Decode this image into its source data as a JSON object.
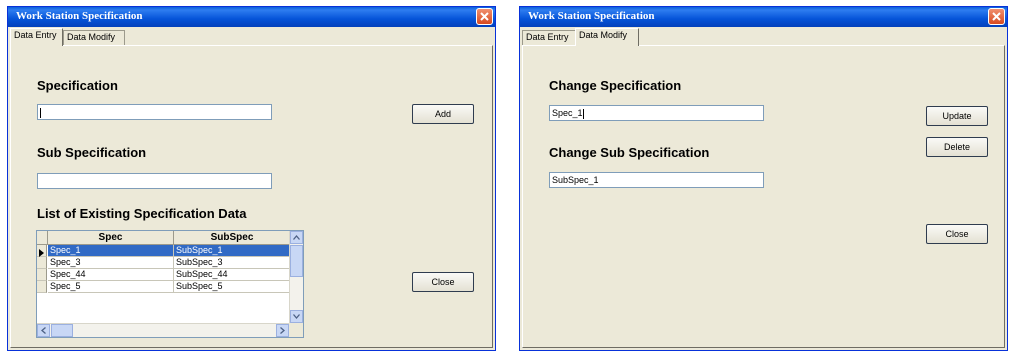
{
  "windows": [
    {
      "title": "Work Station Specification",
      "tabs": [
        "Data Entry",
        "Data Modify"
      ],
      "active_tab": "Data Entry",
      "specification_label": "Specification",
      "specification_value": "",
      "sub_specification_label": "Sub Specification",
      "sub_specification_value": "",
      "list_label": "List of Existing Specification Data",
      "add_button": "Add",
      "close_button": "Close",
      "grid": {
        "columns": [
          "Spec",
          "SubSpec"
        ],
        "rows": [
          [
            "Spec_1",
            "SubSpec_1"
          ],
          [
            "Spec_3",
            "SubSpec_3"
          ],
          [
            "Spec_44",
            "SubSpec_44"
          ],
          [
            "Spec_5",
            "SubSpec_5"
          ]
        ],
        "selected_row": 0
      }
    },
    {
      "title": "Work Station Specification",
      "tabs": [
        "Data Entry",
        "Data Modify"
      ],
      "active_tab": "Data Modify",
      "change_specification_label": "Change Specification",
      "change_specification_value": "Spec_1",
      "change_sub_specification_label": "Change Sub Specification",
      "change_sub_specification_value": "SubSpec_1",
      "update_button": "Update",
      "delete_button": "Delete",
      "close_button": "Close"
    }
  ],
  "colors": {
    "titlebar": "#0553d8",
    "window_bg": "#ece9d8",
    "selection": "#316ac5",
    "close_red": "#d84a20"
  }
}
